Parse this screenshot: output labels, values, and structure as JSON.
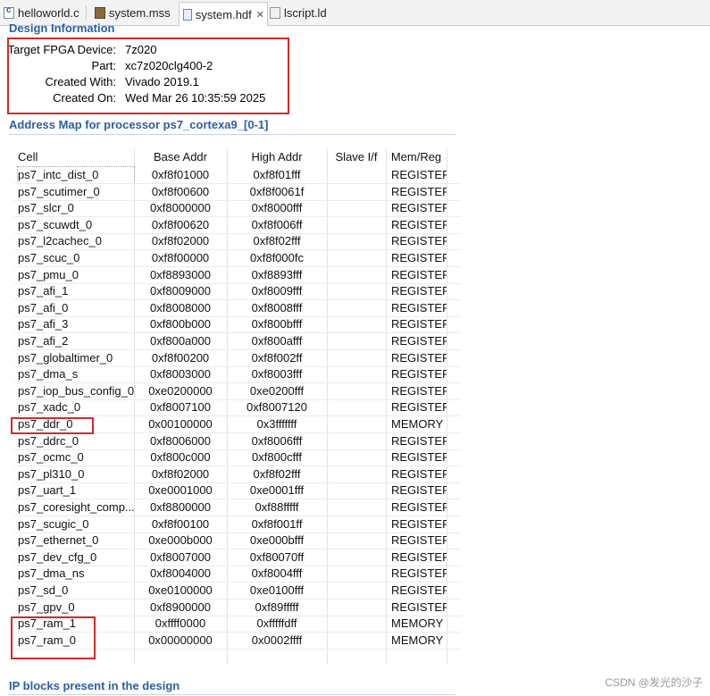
{
  "tabs": [
    {
      "label": "helloworld.c",
      "icon": "c-file-icon"
    },
    {
      "label": "system.mss",
      "icon": "mss-file-icon"
    },
    {
      "label": "system.hdf",
      "icon": "hdf-file-icon",
      "close": "✕"
    },
    {
      "label": "lscript.ld",
      "icon": "linker-script-icon"
    }
  ],
  "design_info": {
    "title": "Design Information",
    "rows": [
      {
        "label": "Target FPGA Device:",
        "value": "7z020"
      },
      {
        "label": "Part:",
        "value": "xc7z020clg400-2"
      },
      {
        "label": "Created With:",
        "value": "Vivado 2019.1"
      },
      {
        "label": "Created On:",
        "value": "Wed Mar 26 10:35:59 2025"
      }
    ]
  },
  "address_map": {
    "title": "Address Map for processor ps7_cortexa9_[0-1]",
    "headers": [
      "Cell",
      "Base Addr",
      "High Addr",
      "Slave I/f",
      "Mem/Reg"
    ],
    "rows": [
      [
        "ps7_intc_dist_0",
        "0xf8f01000",
        "0xf8f01fff",
        "",
        "REGISTER"
      ],
      [
        "ps7_scutimer_0",
        "0xf8f00600",
        "0xf8f0061f",
        "",
        "REGISTER"
      ],
      [
        "ps7_slcr_0",
        "0xf8000000",
        "0xf8000fff",
        "",
        "REGISTER"
      ],
      [
        "ps7_scuwdt_0",
        "0xf8f00620",
        "0xf8f006ff",
        "",
        "REGISTER"
      ],
      [
        "ps7_l2cachec_0",
        "0xf8f02000",
        "0xf8f02fff",
        "",
        "REGISTER"
      ],
      [
        "ps7_scuc_0",
        "0xf8f00000",
        "0xf8f000fc",
        "",
        "REGISTER"
      ],
      [
        "ps7_pmu_0",
        "0xf8893000",
        "0xf8893fff",
        "",
        "REGISTER"
      ],
      [
        "ps7_afi_1",
        "0xf8009000",
        "0xf8009fff",
        "",
        "REGISTER"
      ],
      [
        "ps7_afi_0",
        "0xf8008000",
        "0xf8008fff",
        "",
        "REGISTER"
      ],
      [
        "ps7_afi_3",
        "0xf800b000",
        "0xf800bfff",
        "",
        "REGISTER"
      ],
      [
        "ps7_afi_2",
        "0xf800a000",
        "0xf800afff",
        "",
        "REGISTER"
      ],
      [
        "ps7_globaltimer_0",
        "0xf8f00200",
        "0xf8f002ff",
        "",
        "REGISTER"
      ],
      [
        "ps7_dma_s",
        "0xf8003000",
        "0xf8003fff",
        "",
        "REGISTER"
      ],
      [
        "ps7_iop_bus_config_0",
        "0xe0200000",
        "0xe0200fff",
        "",
        "REGISTER"
      ],
      [
        "ps7_xadc_0",
        "0xf8007100",
        "0xf8007120",
        "",
        "REGISTER"
      ],
      [
        "ps7_ddr_0",
        "0x00100000",
        "0x3fffffff",
        "",
        "MEMORY"
      ],
      [
        "ps7_ddrc_0",
        "0xf8006000",
        "0xf8006fff",
        "",
        "REGISTER"
      ],
      [
        "ps7_ocmc_0",
        "0xf800c000",
        "0xf800cfff",
        "",
        "REGISTER"
      ],
      [
        "ps7_pl310_0",
        "0xf8f02000",
        "0xf8f02fff",
        "",
        "REGISTER"
      ],
      [
        "ps7_uart_1",
        "0xe0001000",
        "0xe0001fff",
        "",
        "REGISTER"
      ],
      [
        "ps7_coresight_comp...",
        "0xf8800000",
        "0xf88fffff",
        "",
        "REGISTER"
      ],
      [
        "ps7_scugic_0",
        "0xf8f00100",
        "0xf8f001ff",
        "",
        "REGISTER"
      ],
      [
        "ps7_ethernet_0",
        "0xe000b000",
        "0xe000bfff",
        "",
        "REGISTER"
      ],
      [
        "ps7_dev_cfg_0",
        "0xf8007000",
        "0xf80070ff",
        "",
        "REGISTER"
      ],
      [
        "ps7_dma_ns",
        "0xf8004000",
        "0xf8004fff",
        "",
        "REGISTER"
      ],
      [
        "ps7_sd_0",
        "0xe0100000",
        "0xe0100fff",
        "",
        "REGISTER"
      ],
      [
        "ps7_gpv_0",
        "0xf8900000",
        "0xf89fffff",
        "",
        "REGISTER"
      ],
      [
        "ps7_ram_1",
        "0xffff0000",
        "0xfffffdff",
        "",
        "MEMORY"
      ],
      [
        "ps7_ram_0",
        "0x00000000",
        "0x0002ffff",
        "",
        "MEMORY"
      ]
    ]
  },
  "ip_blocks": {
    "title": "IP blocks present in the design"
  },
  "watermark": "CSDN @发光的沙子",
  "colors": {
    "section_title": "#2a5ea8",
    "annotation_box": "#d32a2a"
  }
}
